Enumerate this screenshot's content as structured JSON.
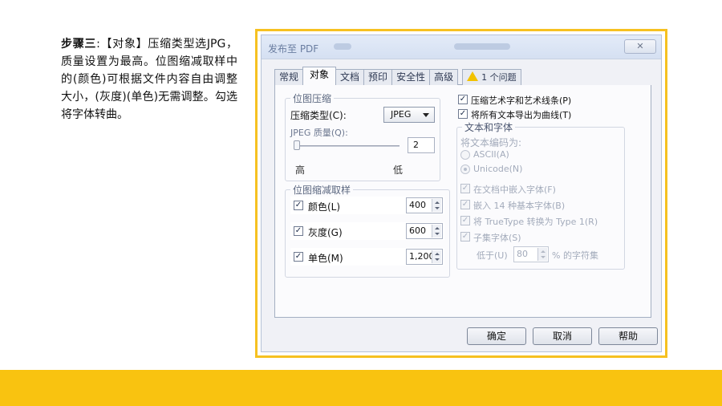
{
  "instruction": {
    "step_label": "步骤三",
    "body": ":【对象】压缩类型选JPG，质量设置为最高。位图缩减取样中的(颜色)可根据文件内容自由调整大小，(灰度)(单色)无需调整。勾选将字体转曲。"
  },
  "dialog": {
    "title": "发布至 PDF",
    "close_glyph": "✕",
    "tabs": [
      "常规",
      "对象",
      "文档",
      "预印",
      "安全性",
      "高级"
    ],
    "issue_tab": "1 个问题",
    "compression": {
      "legend": "位图压缩",
      "type_label": "压缩类型(C):",
      "type_value": "JPEG",
      "quality_label": "JPEG 质量(Q):",
      "quality_value": "2",
      "quality_level": 0.0,
      "high_label": "高",
      "low_label": "低"
    },
    "downsample": {
      "legend": "位图缩减取样",
      "rows": [
        {
          "label": "颜色(L)",
          "value": "400",
          "checked": true
        },
        {
          "label": "灰度(G)",
          "value": "600",
          "checked": true
        },
        {
          "label": "单色(M)",
          "value": "1,200",
          "checked": true
        }
      ]
    },
    "options": {
      "compress_art_text": "压缩艺术字和艺术线条(P)",
      "export_text_curves": "将所有文本导出为曲线(T)"
    },
    "text_fonts": {
      "legend": "文本和字体",
      "encode_label": "将文本编码为:",
      "ascii": "ASCII(A)",
      "unicode": "Unicode(N)",
      "embed_fonts": "在文档中嵌入字体(F)",
      "embed_base14": "嵌入 14 种基本字体(B)",
      "truetype_type1": "将 TrueType 转换为 Type 1(R)",
      "subset_fonts": "子集字体(S)",
      "below_label": "低于(U)",
      "below_value": "80",
      "below_suffix": "% 的字符集"
    },
    "buttons": {
      "ok": "确定",
      "cancel": "取消",
      "help": "帮助"
    }
  },
  "colors": {
    "accent_band": "#f9c310",
    "frame_border": "#f6c121"
  }
}
